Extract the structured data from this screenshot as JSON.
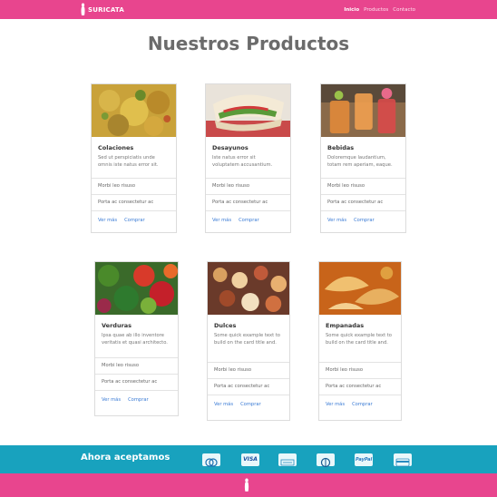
{
  "navbar": {
    "brand": "SURICATA",
    "links": [
      {
        "label": "Inicio",
        "active": true
      },
      {
        "label": "Productos",
        "active": false
      },
      {
        "label": "Contacto",
        "active": false
      }
    ]
  },
  "page_title": "Nuestros Productos",
  "products": [
    {
      "title": "Colaciones",
      "text": "Sed ut perspiciatis unde omnis iste natus error sit.",
      "items": [
        "Morbi leo risuso",
        "Porta ac consectetur ac"
      ],
      "links": [
        "Ver más",
        "Comprar"
      ],
      "image": "snack-image"
    },
    {
      "title": "Desayunos",
      "text": "Iste natus error sit voluptatem accusantium.",
      "items": [
        "Morbi leo risuso",
        "Porta ac consectetur ac"
      ],
      "links": [
        "Ver más",
        "Comprar"
      ],
      "image": "breakfast-image"
    },
    {
      "title": "Bebidas",
      "text": "Doloremque laudantium, totam rem aperiam, eaque.",
      "items": [
        "Morbi leo risuso",
        "Porta ac consectetur ac"
      ],
      "links": [
        "Ver más",
        "Comprar"
      ],
      "image": "drinks-image"
    },
    {
      "title": "Verduras",
      "text": "Ipsa quae ab illo inventore veritatis et quasi architecto.",
      "items": [
        "Morbi leo risuso",
        "Porta ac consectetur ac"
      ],
      "links": [
        "Ver más",
        "Comprar"
      ],
      "image": "vegetables-image"
    },
    {
      "title": "Dulces",
      "text": "Some quick example text to build on the card title and.",
      "items": [
        "Morbi leo risuso",
        "Porta ac consectetur ac"
      ],
      "links": [
        "Ver más",
        "Comprar"
      ],
      "image": "sweets-image"
    },
    {
      "title": "Empanadas",
      "text": "Some quick example text to build on the card title and.",
      "items": [
        "Morbi leo risuso",
        "Porta ac consectetur ac"
      ],
      "links": [
        "Ver más",
        "Comprar"
      ],
      "image": "empanadas-image"
    }
  ],
  "footer": {
    "payments_label": "Ahora aceptamos",
    "payment_icons": [
      {
        "name": "diners-club-icon",
        "text": ""
      },
      {
        "name": "visa-icon",
        "text": "VISA"
      },
      {
        "name": "american-express-icon",
        "text": ""
      },
      {
        "name": "diners-club-alt-icon",
        "text": ""
      },
      {
        "name": "paypal-icon",
        "text": "PayPal"
      },
      {
        "name": "generic-card-icon",
        "text": ""
      }
    ]
  },
  "colors": {
    "brand_pink": "#e8458e",
    "footer_teal": "#18a2be",
    "link_blue": "#3a7bd5"
  }
}
